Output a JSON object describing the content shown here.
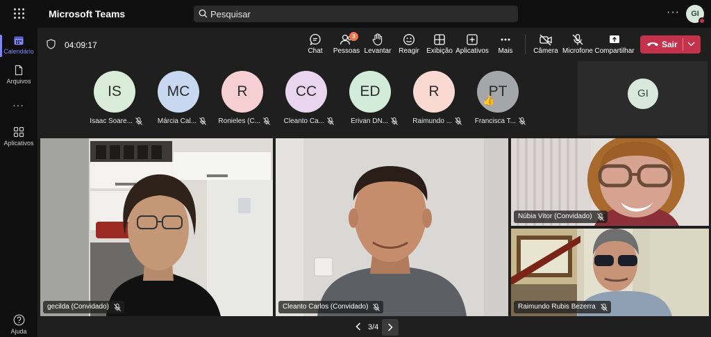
{
  "app": {
    "title": "Microsoft Teams",
    "search_placeholder": "Pesquisar",
    "more": "···",
    "user_initials": "GI"
  },
  "rail": [
    {
      "label": "Calendário",
      "icon": "calendar-icon",
      "active": true
    },
    {
      "label": "Arquivos",
      "icon": "file-icon",
      "active": false
    },
    {
      "label": "Aplicativos",
      "icon": "apps-icon",
      "active": false
    },
    {
      "label": "Ajuda",
      "icon": "help-icon",
      "active": false
    }
  ],
  "rail_more": "···",
  "meeting": {
    "timer": "04:09:17",
    "controls": {
      "chat": "Chat",
      "people": "Pessoas",
      "people_count": "3",
      "raise": "Levantar",
      "react": "Reagir",
      "view": "Exibição",
      "apps": "Aplicativos",
      "more": "Mais",
      "camera": "Câmera",
      "mic": "Microfone",
      "share": "Compartilhar",
      "leave": "Sair"
    }
  },
  "participants": [
    {
      "initials": "IS",
      "name": "Isaac Soare...",
      "color": "#d9ecd7"
    },
    {
      "initials": "MC",
      "name": "Márcia Cal...",
      "color": "#c8d8f0"
    },
    {
      "initials": "R",
      "name": "Ronieles (C...",
      "color": "#f6cfd2"
    },
    {
      "initials": "CC",
      "name": "Cleanto Ca...",
      "color": "#ead5ee"
    },
    {
      "initials": "ED",
      "name": "Erivan DN...",
      "color": "#d2ecd9"
    },
    {
      "initials": "R",
      "name": "Raimundo ...",
      "color": "#fbd9d3"
    },
    {
      "initials": "PT",
      "name": "Francisca T...",
      "color": "#a4a6a8",
      "hand": "👍"
    }
  ],
  "self": {
    "initials": "GI",
    "color": "#d8e8dc"
  },
  "videos": [
    {
      "label": "gecilda (Convidado)"
    },
    {
      "label": "Cleanto Carlos (Convidado)"
    },
    {
      "label": "Núbia Vitor (Convidado)"
    },
    {
      "label": "Raimundo Rubis Bezerra"
    }
  ],
  "pager": {
    "text": "3/4"
  },
  "colors": {
    "accent": "#7f85f5",
    "leave": "#c4314b",
    "badge": "#e97548"
  }
}
